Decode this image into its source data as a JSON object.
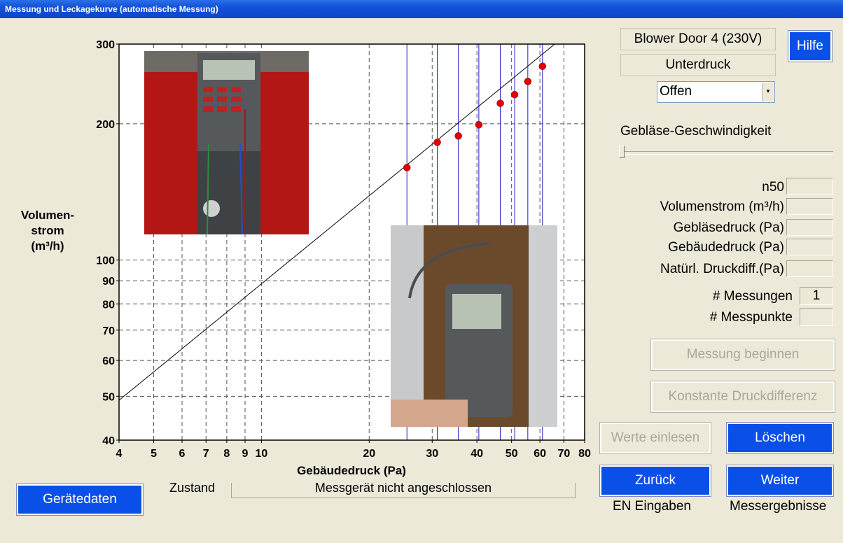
{
  "window": {
    "title": "Messung und Leckagekurve (automatische Messung)"
  },
  "device": {
    "name": "Blower Door 4 (230V)",
    "mode": "Unterdruck",
    "state_select": "Offen",
    "help_label": "Hilfe"
  },
  "fan_speed": {
    "label": "Gebläse-Geschwindigkeit",
    "level": 0
  },
  "readouts": [
    {
      "label": "n50",
      "value": ""
    },
    {
      "label": "Volumenstrom (m³/h)",
      "value": ""
    },
    {
      "label": "Gebläsedruck (Pa)",
      "value": ""
    },
    {
      "label": "Gebäudedruck (Pa)",
      "value": ""
    },
    {
      "label": "Natürl. Druckdiff.(Pa)",
      "value": ""
    }
  ],
  "counts": [
    {
      "label": "# Messungen",
      "value": "1"
    },
    {
      "label": "# Messpunkte",
      "value": ""
    }
  ],
  "buttons": {
    "start": "Messung beginnen",
    "constant": "Konstante Druckdifferenz",
    "read_values": "Werte einlesen",
    "delete": "Löschen",
    "back": "Zurück",
    "next": "Weiter",
    "device_data": "Gerätedaten"
  },
  "captions": {
    "back": "EN Eingaben",
    "next": "Messergebnisse"
  },
  "status": {
    "label": "Zustand",
    "text": "Messgerät nicht angeschlossen"
  },
  "photos": {
    "gauge1": "pressure-gauge-photo",
    "gauge2": "anemometer-photo"
  },
  "chart_data": {
    "type": "scatter",
    "xlabel": "Gebäudedruck (Pa)",
    "ylabel": "Volumen-\nstrom\n(m³/h)",
    "xscale": "log",
    "yscale": "log",
    "xlim": [
      4,
      80
    ],
    "ylim": [
      40,
      300
    ],
    "xticks": [
      4,
      5,
      6,
      7,
      8,
      9,
      10,
      20,
      30,
      40,
      50,
      60,
      70,
      80
    ],
    "yticks": [
      40,
      50,
      60,
      70,
      80,
      90,
      100,
      200,
      300
    ],
    "grid": true,
    "points": [
      {
        "x": 25.5,
        "y": 160
      },
      {
        "x": 31,
        "y": 182
      },
      {
        "x": 35.5,
        "y": 188
      },
      {
        "x": 40.5,
        "y": 199
      },
      {
        "x": 46.5,
        "y": 222
      },
      {
        "x": 51,
        "y": 232
      },
      {
        "x": 55.5,
        "y": 248
      },
      {
        "x": 61,
        "y": 268
      }
    ],
    "vertical_lines": [
      25.5,
      31,
      35.5,
      40.5,
      46.5,
      51,
      55.5,
      61
    ],
    "fit_line": [
      {
        "x": 4,
        "y": 49
      },
      {
        "x": 66,
        "y": 300
      }
    ],
    "point_color": "#E00000",
    "vline_color": "#2020C8"
  }
}
